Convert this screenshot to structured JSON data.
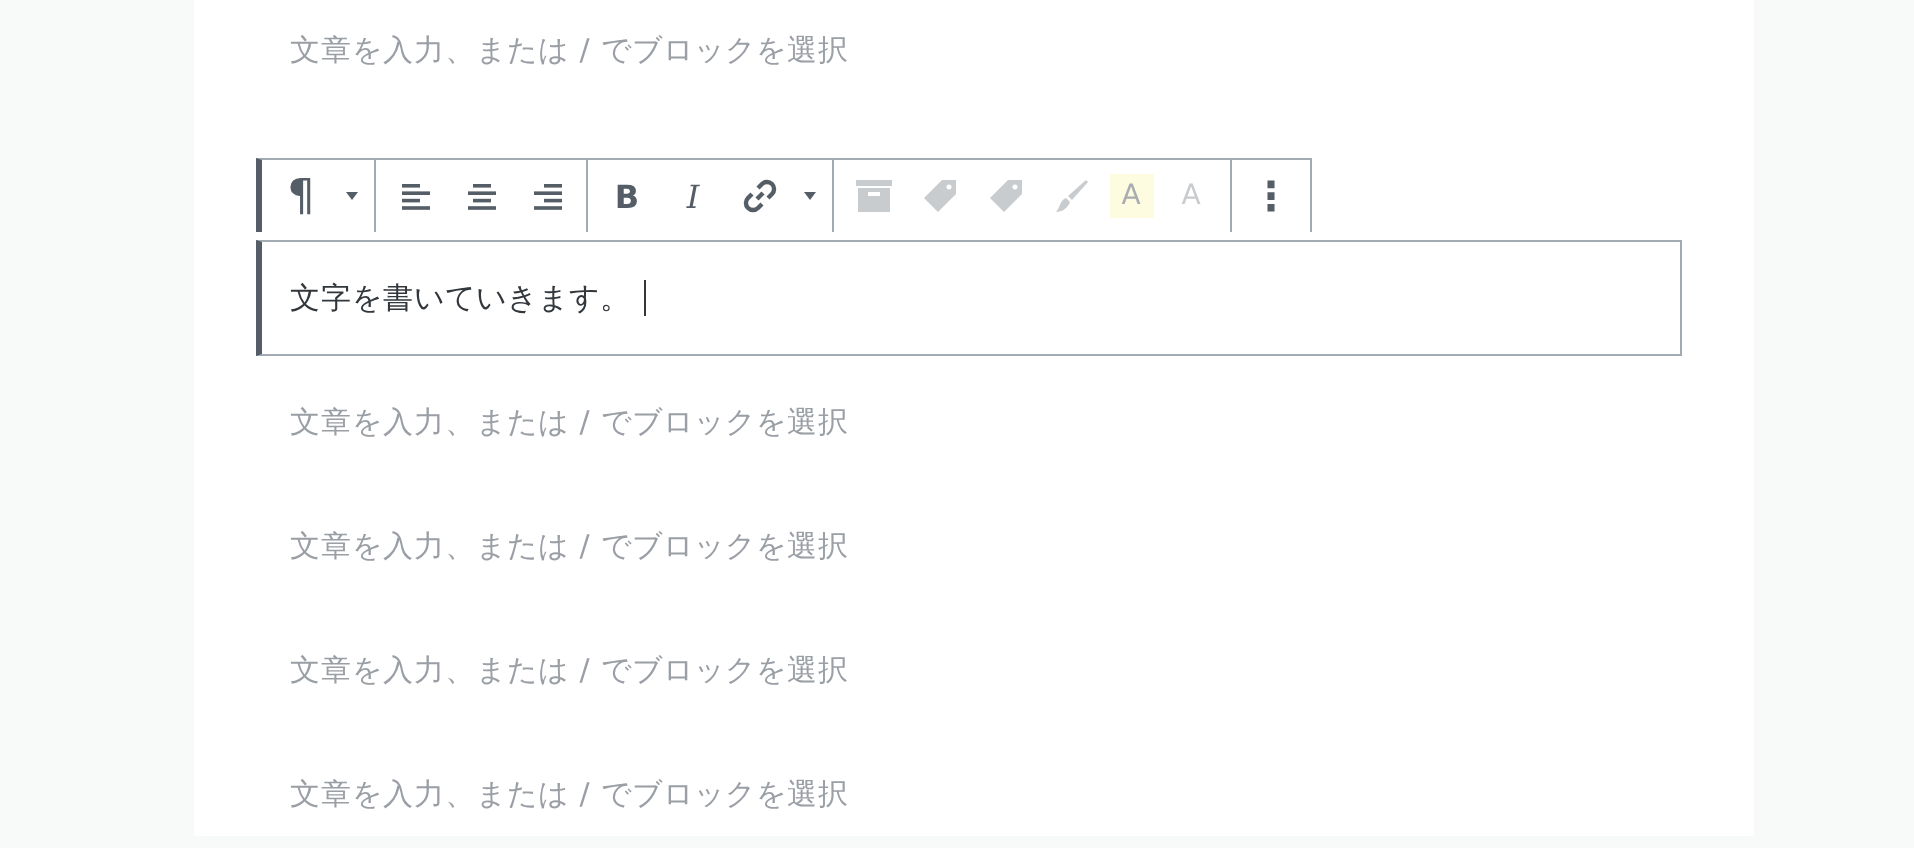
{
  "blocks_before": [
    {
      "placeholder": "文章を入力、または / でブロックを選択"
    }
  ],
  "toolbar": {
    "groups": [
      [
        {
          "kind": "text",
          "label": "¶",
          "disabled": false
        },
        {
          "kind": "caret",
          "disabled": false
        }
      ],
      [
        {
          "kind": "align-left",
          "disabled": false
        },
        {
          "kind": "align-center",
          "disabled": false
        },
        {
          "kind": "align-right",
          "disabled": false
        }
      ],
      [
        {
          "kind": "bold",
          "label": "B",
          "disabled": false
        },
        {
          "kind": "italic",
          "label": "I",
          "disabled": false
        },
        {
          "kind": "link",
          "disabled": false
        },
        {
          "kind": "caret",
          "disabled": false
        }
      ],
      [
        {
          "kind": "archive",
          "disabled": true
        },
        {
          "kind": "tag",
          "disabled": true
        },
        {
          "kind": "tag",
          "disabled": true
        },
        {
          "kind": "brush",
          "disabled": true
        },
        {
          "kind": "highlight",
          "label": "A",
          "disabled": true
        },
        {
          "kind": "text-color",
          "label": "A",
          "disabled": true
        }
      ],
      [
        {
          "kind": "more",
          "label": "⋮",
          "disabled": false
        }
      ]
    ]
  },
  "active_block": {
    "value": "文字を書いていきます。"
  },
  "blocks_after": [
    {
      "placeholder": "文章を入力、または / でブロックを選択"
    },
    {
      "placeholder": "文章を入力、または / でブロックを選択"
    },
    {
      "placeholder": "文章を入力、または / でブロックを選択"
    },
    {
      "placeholder": "文章を入力、または / でブロックを選択"
    }
  ]
}
